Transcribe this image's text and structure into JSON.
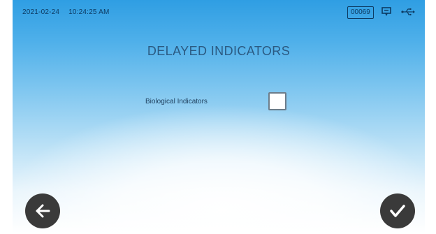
{
  "status_bar": {
    "date": "2021-02-24",
    "time": "10:24:25 AM",
    "counter": "00069",
    "icons": [
      "message-icon",
      "usb-icon"
    ]
  },
  "main": {
    "title": "DELAYED INDICATORS",
    "options": [
      {
        "label": "Biological Indicators",
        "checked": false
      }
    ]
  },
  "footer": {
    "back_icon": "arrow-left-icon",
    "confirm_icon": "checkmark-icon"
  },
  "colors": {
    "text_dark": "#0d3b63",
    "title": "#2b5a82",
    "button": "#3a3a3a"
  }
}
